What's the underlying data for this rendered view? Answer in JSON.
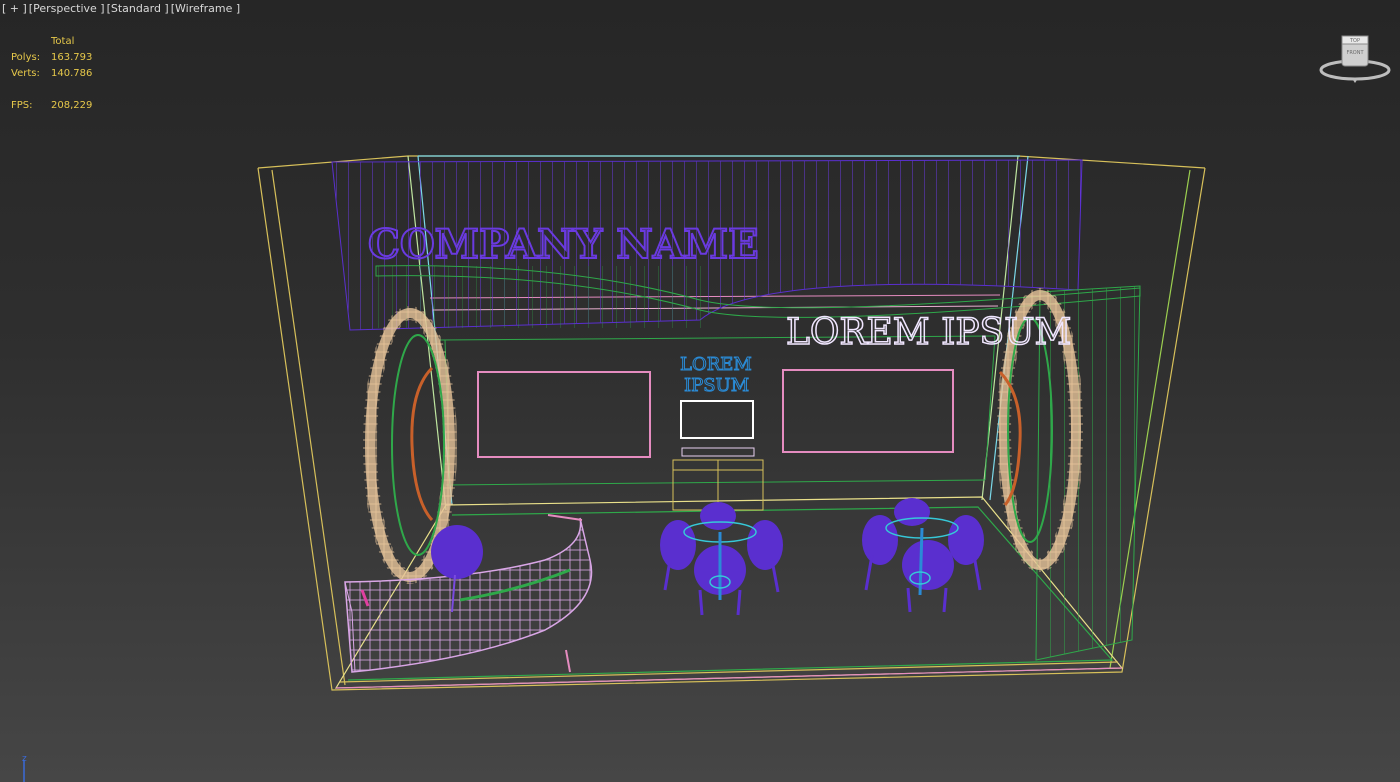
{
  "viewport": {
    "plus": "[ + ]",
    "view": "[Perspective ]",
    "shading_mode": "[Standard ]",
    "render_mode": "[Wireframe ]"
  },
  "stats": {
    "header": "Total",
    "polys_label": "Polys:",
    "polys_value": "163.793",
    "verts_label": "Verts:",
    "verts_value": "140.786",
    "fps_label": "FPS:",
    "fps_value": "208,229"
  },
  "viewcube": {
    "top_label": "TOP",
    "front_label": "FRONT"
  },
  "scene": {
    "company_sign": "COMPANY NAME",
    "lorem_sign": "LOREM IPSUM",
    "center_logo_line1": "LOREM",
    "center_logo_line2": "IPSUM"
  },
  "axis": {
    "z_label": "z"
  },
  "colors": {
    "stats_text": "#e6c84a",
    "label_text": "#d8d8d8",
    "wire_yellow": "#d7c05a",
    "wire_green": "#2fa84a",
    "wire_purple": "#5a2fcf",
    "wire_pink": "#e58cc0",
    "wire_blue": "#2a8bd6",
    "wire_cyan": "#36c8d8"
  }
}
